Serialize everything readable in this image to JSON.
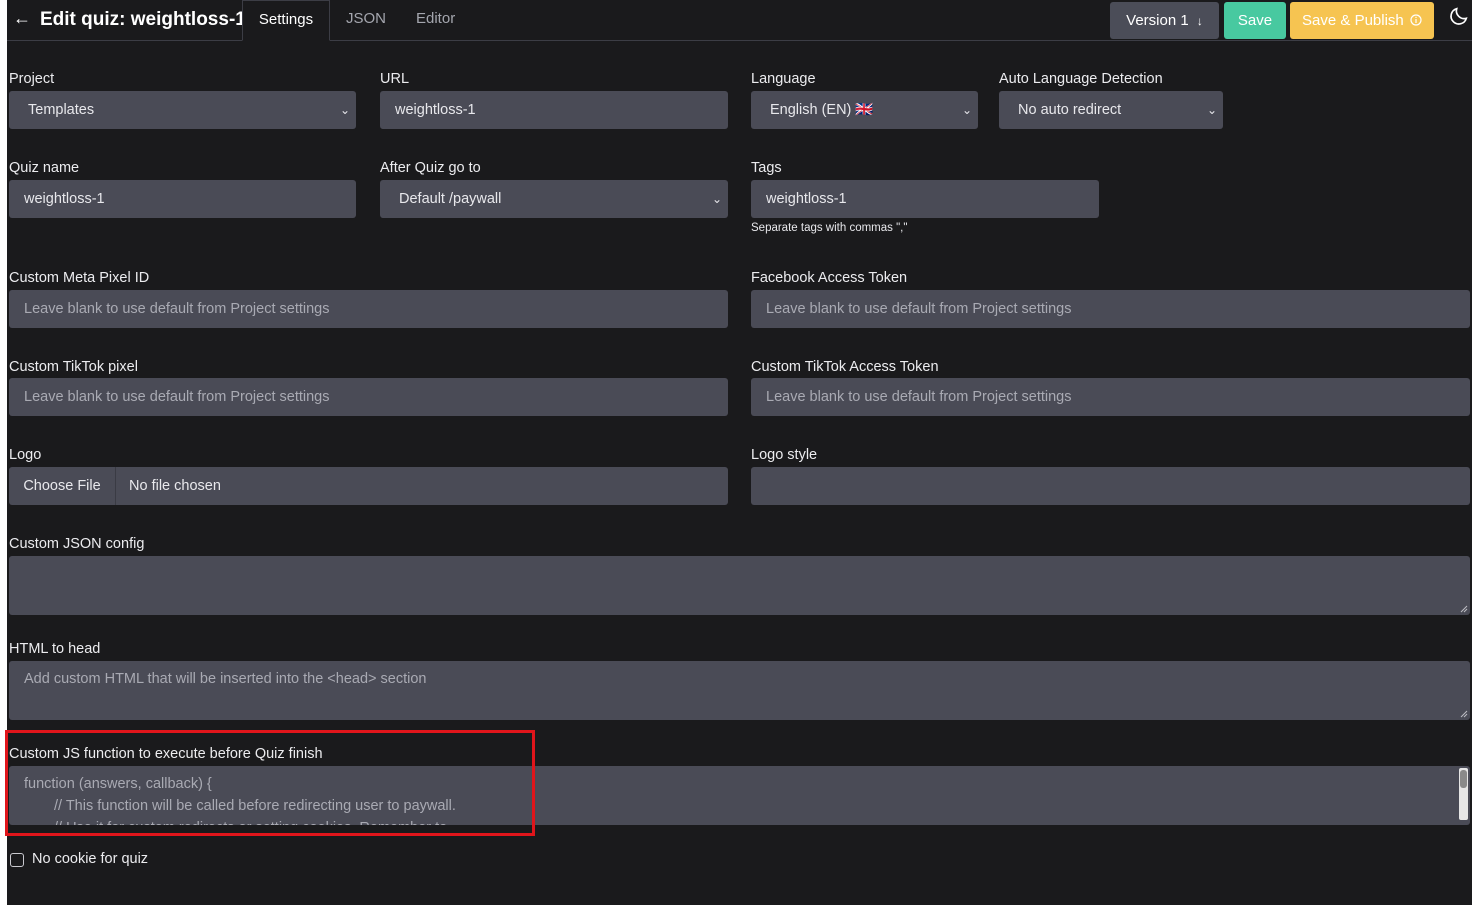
{
  "header": {
    "title": "Edit quiz: weightloss-1",
    "tabs": [
      "Settings",
      "JSON",
      "Editor"
    ],
    "version_label": "Version 1",
    "save_label": "Save",
    "publish_label": "Save & Publish"
  },
  "form": {
    "project": {
      "label": "Project",
      "value": "Templates"
    },
    "url": {
      "label": "URL",
      "value": "weightloss-1"
    },
    "language": {
      "label": "Language",
      "value": "English (EN) 🇬🇧"
    },
    "auto_lang": {
      "label": "Auto Language Detection",
      "value": "No auto redirect"
    },
    "quiz_name": {
      "label": "Quiz name",
      "value": "weightloss-1"
    },
    "after_quiz": {
      "label": "After Quiz go to",
      "value": "Default /paywall"
    },
    "tags": {
      "label": "Tags",
      "value": "weightloss-1",
      "help": "Separate tags with commas \",\""
    },
    "meta_pixel": {
      "label": "Custom Meta Pixel ID",
      "placeholder": "Leave blank to use default from Project settings"
    },
    "fb_token": {
      "label": "Facebook Access Token",
      "placeholder": "Leave blank to use default from Project settings"
    },
    "tiktok_pixel": {
      "label": "Custom TikTok pixel",
      "placeholder": "Leave blank to use default from Project settings"
    },
    "tiktok_token": {
      "label": "Custom TikTok Access Token",
      "placeholder": "Leave blank to use default from Project settings"
    },
    "logo": {
      "label": "Logo",
      "button": "Choose File",
      "status": "No file chosen"
    },
    "logo_style": {
      "label": "Logo style",
      "value": ""
    },
    "custom_json": {
      "label": "Custom JSON config",
      "value": ""
    },
    "html_head": {
      "label": "HTML to head",
      "placeholder": "Add custom HTML that will be inserted into the <head> section"
    },
    "custom_js": {
      "label": "Custom JS function to execute before Quiz finish",
      "line1": "function (answers, callback) {",
      "line2": "// This function will be called before redirecting user to paywall.",
      "line3": "// Use it for custom redirects or setting cookies. Remember to..."
    },
    "no_cookie": {
      "label": "No cookie for quiz",
      "checked": false
    }
  },
  "colors": {
    "background": "#1a1a1c",
    "input_bg": "#4a4b56",
    "save_btn": "#48c9a0",
    "publish_btn": "#f6c451",
    "version_btn": "#4b4d58",
    "highlight_border": "#e0151b"
  }
}
